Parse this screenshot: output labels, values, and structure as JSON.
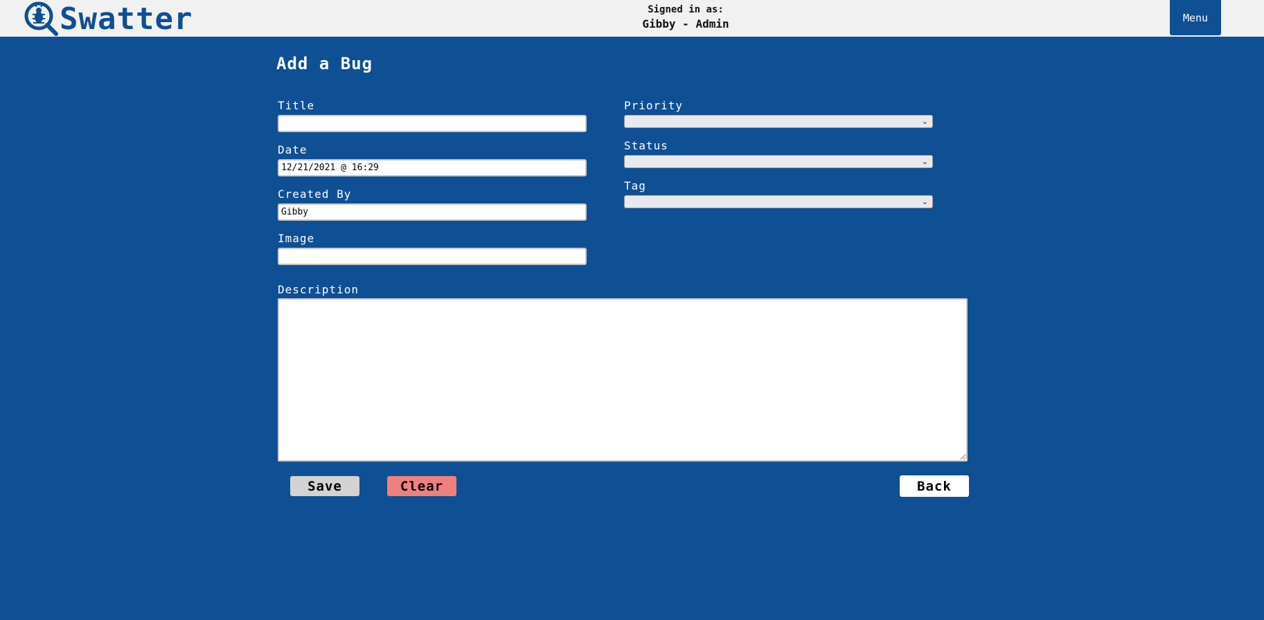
{
  "header": {
    "app_name": "Swatter",
    "signed_in_label": "Signed in as:",
    "signed_in_user": "Gibby - Admin",
    "menu_label": "Menu"
  },
  "page": {
    "title": "Add a Bug"
  },
  "form": {
    "title_label": "Title",
    "title_value": "",
    "date_label": "Date",
    "date_value": "12/21/2021 @ 16:29",
    "created_by_label": "Created By",
    "created_by_value": "Gibby",
    "image_label": "Image",
    "image_value": "",
    "priority_label": "Priority",
    "priority_value": "",
    "status_label": "Status",
    "status_value": "",
    "tag_label": "Tag",
    "tag_value": "",
    "description_label": "Description",
    "description_value": ""
  },
  "actions": {
    "save_label": "Save",
    "clear_label": "Clear",
    "back_label": "Back"
  },
  "colors": {
    "background": "#0f4f94",
    "header": "#f1f1f1",
    "save_button": "#d3d3d3",
    "clear_button": "#f08080",
    "back_button": "#ffffff"
  },
  "icons": {
    "logo": "bug-magnifier-icon",
    "select_arrow": "chevron-down-icon",
    "textarea_resize": "resize-grip-icon"
  }
}
